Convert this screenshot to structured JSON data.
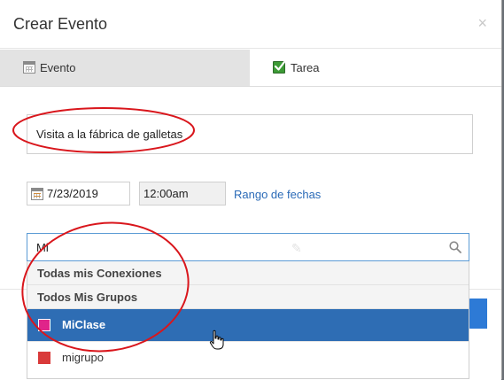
{
  "dialog": {
    "title": "Crear Evento",
    "close_symbol": "×"
  },
  "tabs": [
    {
      "label": "Evento",
      "icon": "calendar-icon",
      "active": true
    },
    {
      "label": "Tarea",
      "icon": "checkbox-checked-icon",
      "active": false
    }
  ],
  "event": {
    "title_value": "Visita a la fábrica de galletas",
    "date_value": "7/23/2019",
    "time_value": "12:00am",
    "date_range_link": "Rango de fechas"
  },
  "audience_search": {
    "value": "Mi"
  },
  "dropdown": {
    "headers": [
      "Todas mis Conexiones",
      "Todos Mis Grupos"
    ],
    "items": [
      {
        "label": "MiClase",
        "color": "#e0248a",
        "selected": true
      },
      {
        "label": "migrupo",
        "color": "#d93a3a",
        "selected": false
      }
    ]
  },
  "colors": {
    "accent": "#2e6db4",
    "link": "#2a6ab7",
    "annotation": "#d9161c"
  }
}
